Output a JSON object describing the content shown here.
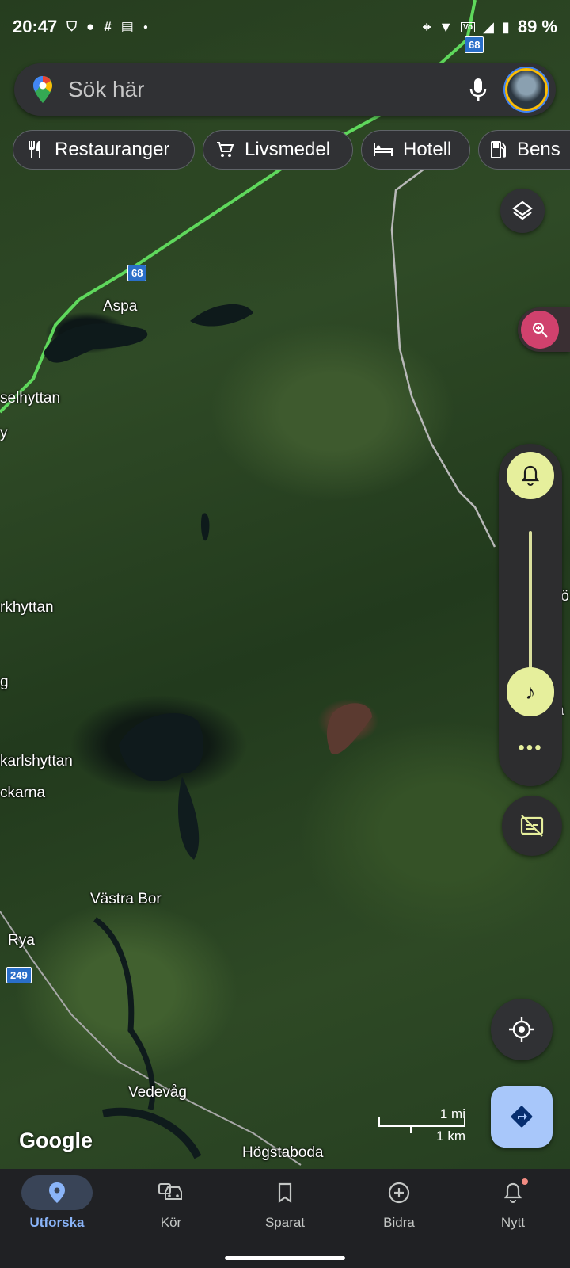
{
  "status_bar": {
    "time": "20:47",
    "battery": "89 %",
    "road_shield_top": "68"
  },
  "search": {
    "placeholder": "Sök här"
  },
  "chips": [
    {
      "label": "Restauranger",
      "icon": "restaurant-icon"
    },
    {
      "label": "Livsmedel",
      "icon": "cart-icon"
    },
    {
      "label": "Hotell",
      "icon": "bed-icon"
    },
    {
      "label": "Bens",
      "icon": "fuel-icon"
    }
  ],
  "map": {
    "places": [
      "Aspa",
      "selhyttan",
      "y",
      "rkhyttan",
      "g",
      "karlshyttan",
      "ckarna",
      "Västra Bor",
      "Rya",
      "Vedevåg",
      "Högstaboda",
      "rö",
      "a"
    ],
    "road_shields": [
      "68",
      "249"
    ],
    "scale": {
      "imperial": "1 mi",
      "metric": "1 km"
    },
    "logo": "Google"
  },
  "media": {
    "more_label": "•••"
  },
  "bottom_nav": [
    {
      "label": "Utforska",
      "icon": "location-pin-icon",
      "active": true
    },
    {
      "label": "Kör",
      "icon": "car-icon",
      "active": false
    },
    {
      "label": "Sparat",
      "icon": "bookmark-icon",
      "active": false
    },
    {
      "label": "Bidra",
      "icon": "add-circle-icon",
      "active": false
    },
    {
      "label": "Nytt",
      "icon": "bell-icon",
      "active": false
    }
  ],
  "colors": {
    "accent_blue": "#8ab4f8",
    "media_yellow": "#e6ef9c",
    "zoom_pink": "#d0416d",
    "highway_green": "#5fd85c"
  }
}
